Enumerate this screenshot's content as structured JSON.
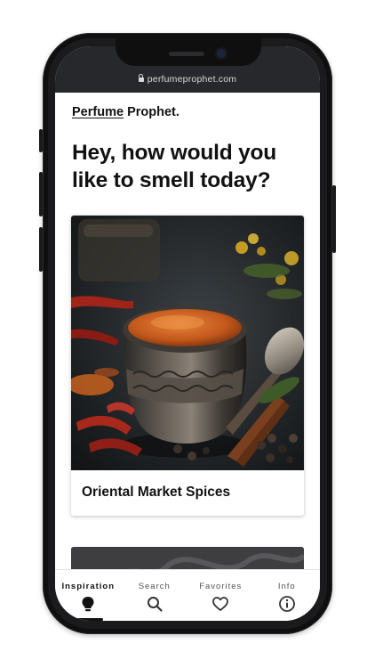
{
  "browser": {
    "url": "perfumeprophet.com"
  },
  "site": {
    "logo_word1": "Perfume",
    "logo_word2": "Prophet."
  },
  "hero": {
    "headline": "Hey, how would you like to smell today?"
  },
  "cards": [
    {
      "title": "Oriental Market Spices",
      "image": "spice-pot-photo"
    },
    {
      "title": "",
      "image": "smoke-photo"
    }
  ],
  "bottom_nav": {
    "items": [
      {
        "label": "Inspiration",
        "icon": "lightbulb-icon",
        "active": true
      },
      {
        "label": "Search",
        "icon": "search-icon",
        "active": false
      },
      {
        "label": "Favorites",
        "icon": "heart-icon",
        "active": false
      },
      {
        "label": "Info",
        "icon": "info-icon",
        "active": false
      }
    ]
  },
  "colors": {
    "frame": "#0f0f10",
    "url_bar": "#27282b",
    "text": "#111111"
  }
}
